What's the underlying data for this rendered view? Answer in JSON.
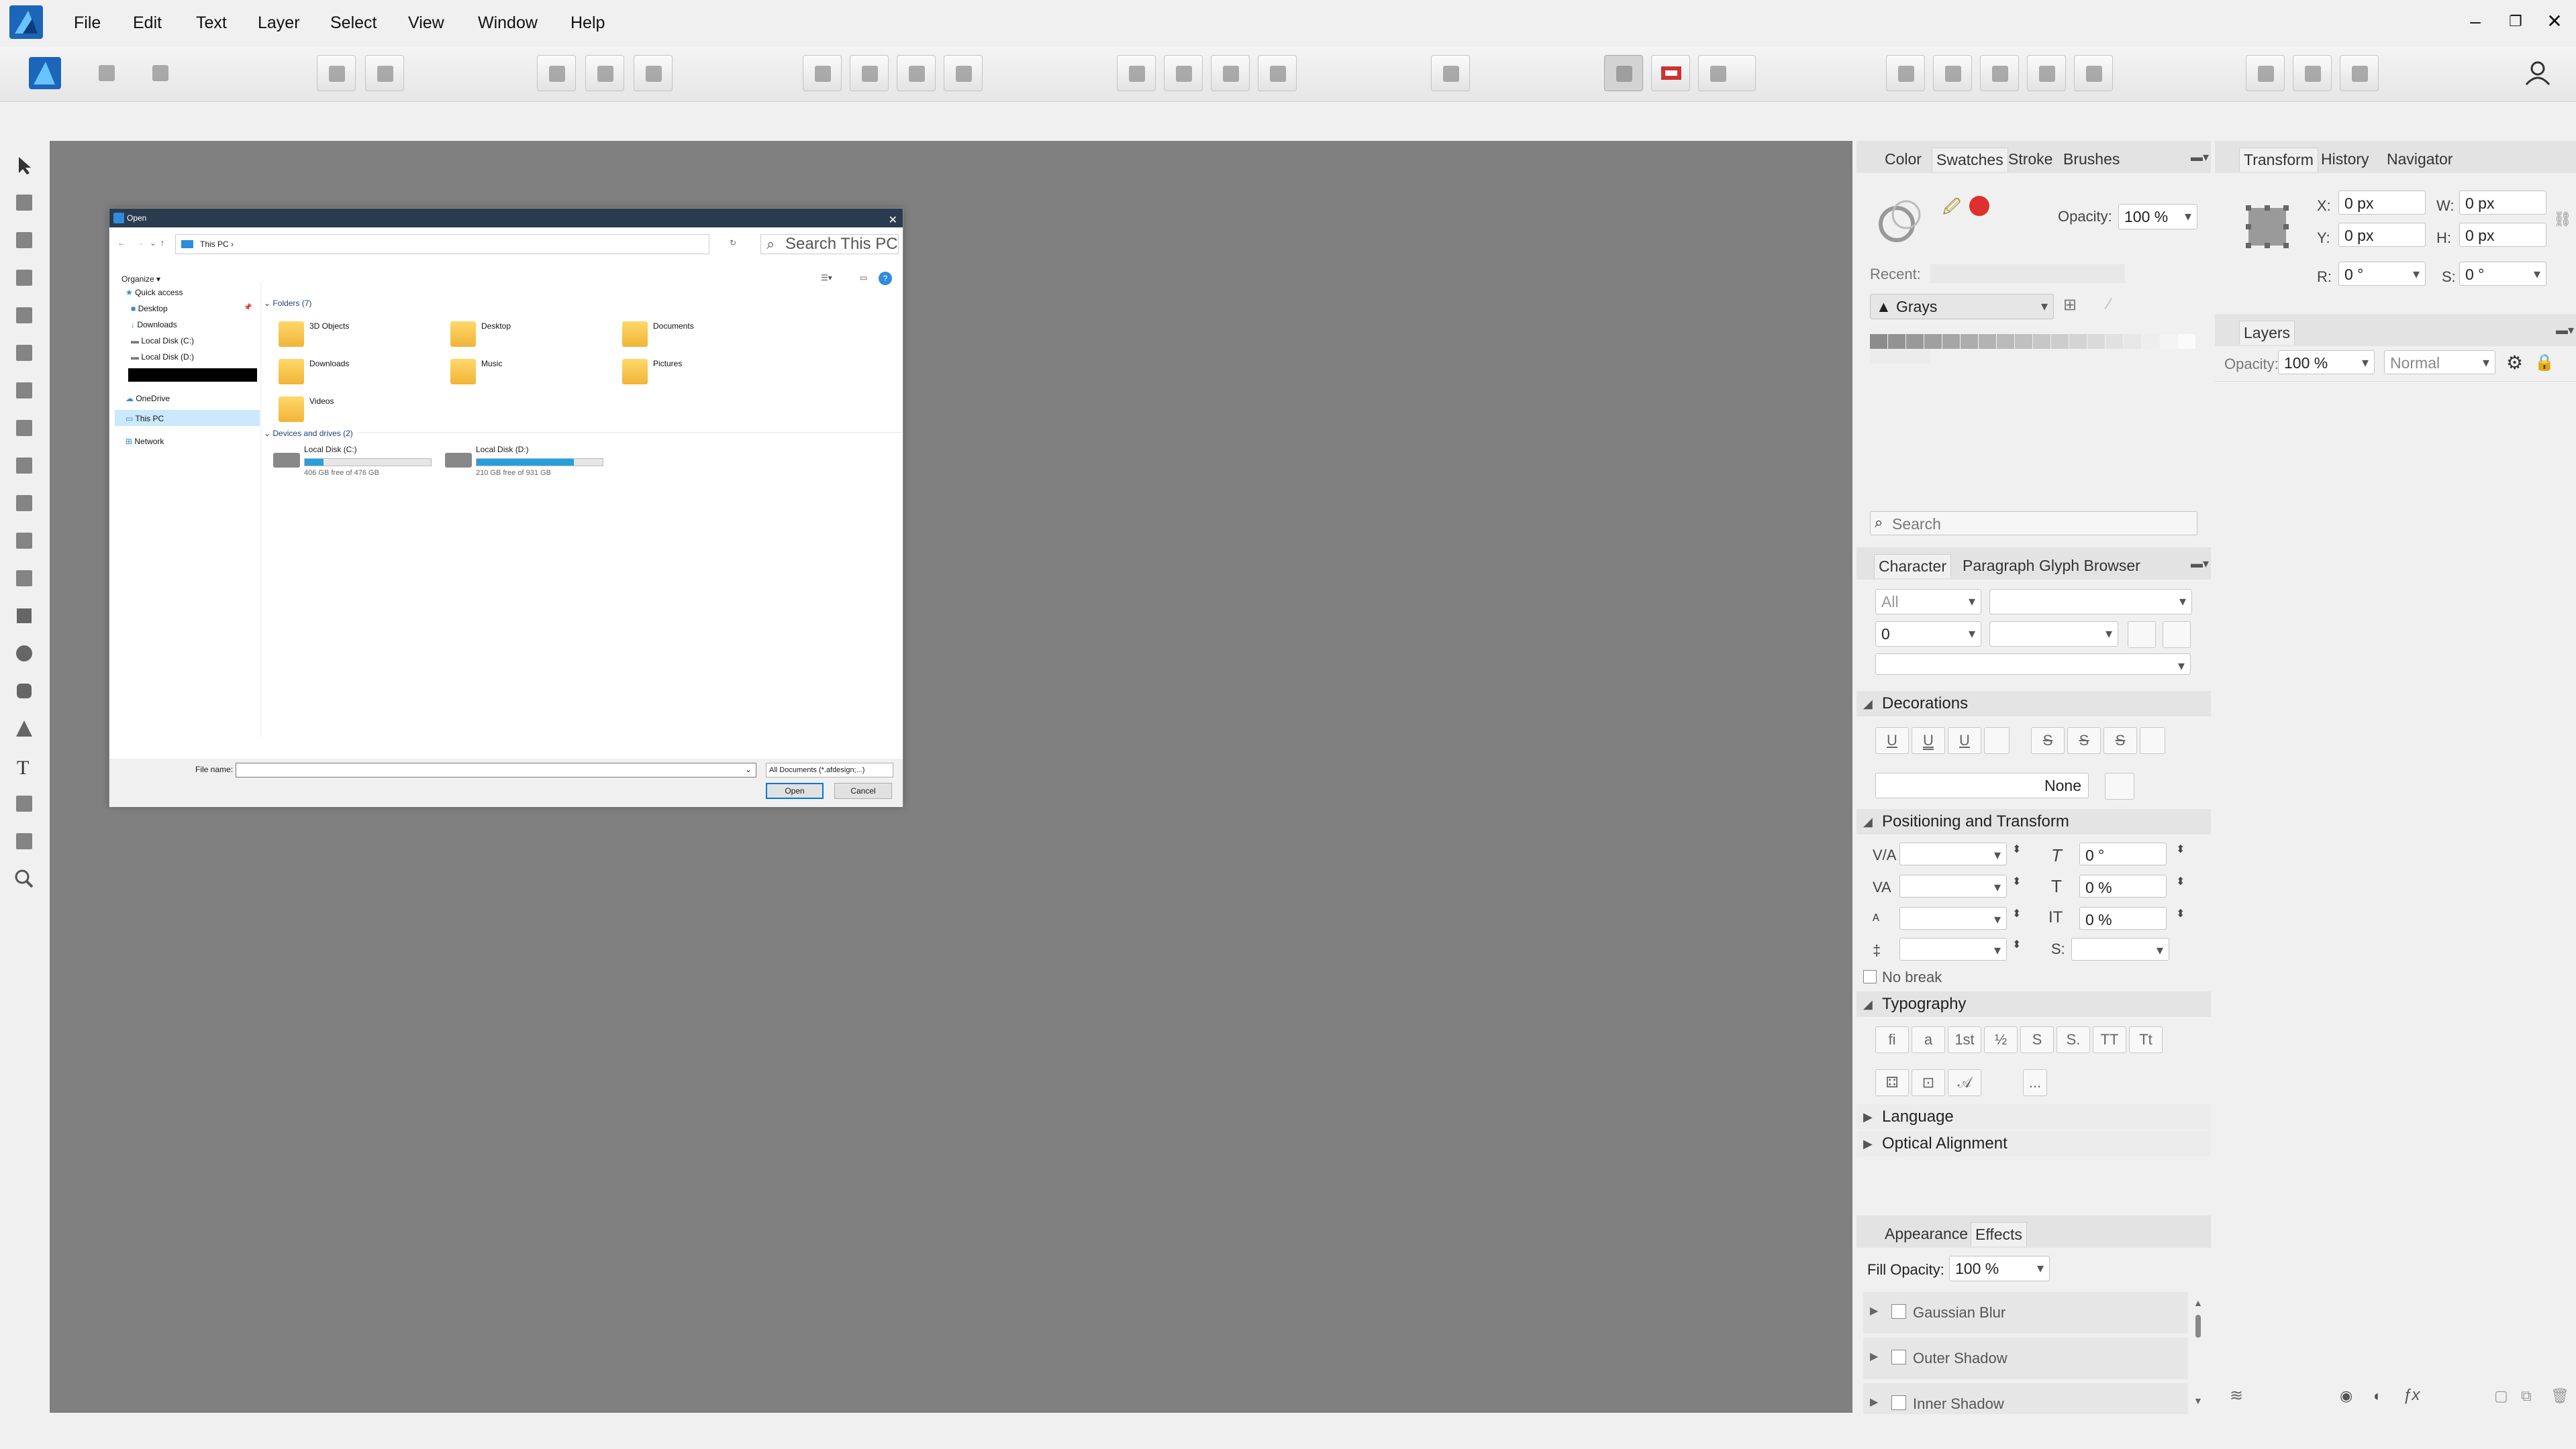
{
  "menus": [
    "File",
    "Edit",
    "Text",
    "Layer",
    "Select",
    "View",
    "Window",
    "Help"
  ],
  "window_controls": {
    "minimize": "–",
    "restore": "❐",
    "close": "✕"
  },
  "dialog": {
    "title": "Open",
    "close": "✕",
    "address": "This PC",
    "search_placeholder": "Search This PC",
    "organize": "Organize ▾",
    "nav": {
      "quick_access": "Quick access",
      "items": [
        "Desktop",
        "Downloads",
        "Local Disk (C:)",
        "Local Disk (D:)"
      ],
      "onedrive": "OneDrive",
      "this_pc": "This PC",
      "network": "Network"
    },
    "folders_header": "Folders (7)",
    "folders": [
      "3D Objects",
      "Desktop",
      "Documents",
      "Downloads",
      "Music",
      "Pictures",
      "Videos"
    ],
    "drives_header": "Devices and drives (2)",
    "drives": [
      {
        "name": "Local Disk (C:)",
        "free": "406 GB free of 476 GB",
        "used_fraction": 0.15
      },
      {
        "name": "Local Disk (D:)",
        "free": "210 GB free of 931 GB",
        "used_fraction": 0.77
      }
    ],
    "filename_label": "File name:",
    "filetype": "All Documents (*.afdesign;...)",
    "open": "Open",
    "cancel": "Cancel"
  },
  "swatches_panel": {
    "tabs": [
      "Color",
      "Swatches",
      "Stroke",
      "Brushes"
    ],
    "active": "Swatches",
    "opacity_label": "Opacity:",
    "opacity": "100 %",
    "recent_label": "Recent:",
    "palette": "Grays",
    "search_placeholder": "Search",
    "swatch_color": "#e02f2f"
  },
  "character_panel": {
    "tabs": [
      "Character",
      "Paragraph",
      "Glyph Browser"
    ],
    "active": "Character",
    "font_collection": "All",
    "size": "0",
    "decorations": "Decorations",
    "decoration_glyphs": [
      "U",
      "U",
      "U",
      "S",
      "S",
      "S"
    ],
    "none": "None",
    "positioning": "Positioning and Transform",
    "skew": "0 °",
    "scale_v": "0 %",
    "scale_h": "0 %",
    "s_label": "S:",
    "no_break": "No break",
    "typography": "Typography",
    "typo_glyphs": [
      "fi",
      "a",
      "1st",
      "½",
      "S",
      "S.",
      "TT",
      "Tt"
    ],
    "more": "...",
    "language": "Language",
    "optical_alignment": "Optical Alignment"
  },
  "effects_panel": {
    "tabs": [
      "Appearance",
      "Effects"
    ],
    "active": "Effects",
    "fill_opacity_label": "Fill Opacity:",
    "fill_opacity": "100 %",
    "effects": [
      "Gaussian Blur",
      "Outer Shadow",
      "Inner Shadow"
    ]
  },
  "transform_panel": {
    "tabs": [
      "Transform",
      "History",
      "Navigator"
    ],
    "active": "Transform",
    "x_label": "X:",
    "x": "0 px",
    "y_label": "Y:",
    "y": "0 px",
    "w_label": "W:",
    "w": "0 px",
    "h_label": "H:",
    "h": "0 px",
    "r_label": "R:",
    "r": "0 °",
    "s_label": "S:",
    "s": "0 °"
  },
  "layers_panel": {
    "title": "Layers",
    "opacity_label": "Opacity:",
    "opacity": "100 %",
    "blend_mode": "Normal"
  },
  "colors": {
    "canvas": "#808080",
    "accent": "#2f8bdc",
    "titlebar": "#2b3b4f"
  }
}
